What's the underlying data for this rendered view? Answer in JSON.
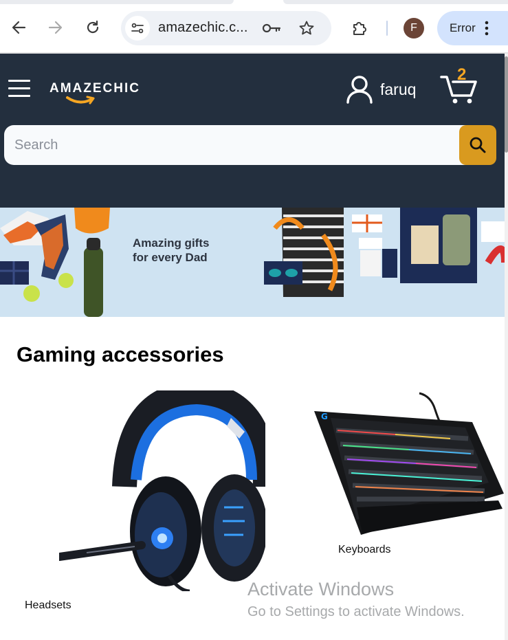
{
  "browser": {
    "url": "amazechic.c...",
    "profile_initial": "F",
    "error_label": "Error",
    "icons": [
      "back-arrow-icon",
      "forward-arrow-icon",
      "reload-icon",
      "site-settings-icon",
      "key-icon",
      "star-icon",
      "extensions-icon",
      "kebab-menu-icon"
    ]
  },
  "header": {
    "brand": "AMAZECHIC",
    "username": "faruq",
    "cart_count": "2",
    "search_placeholder": "Search",
    "colors": {
      "background": "#232f3e",
      "accent": "#d99a1f",
      "cart_badge": "#f5a623"
    }
  },
  "banner": {
    "headline_line1": "Amazing gifts",
    "headline_line2": "for every Dad"
  },
  "section": {
    "title": "Gaming accessories",
    "products": [
      {
        "label": "Headsets"
      },
      {
        "label": "Keyboards"
      }
    ]
  },
  "os_overlay": {
    "line1": "Activate Windows",
    "line2": "Go to Settings to activate Windows."
  }
}
